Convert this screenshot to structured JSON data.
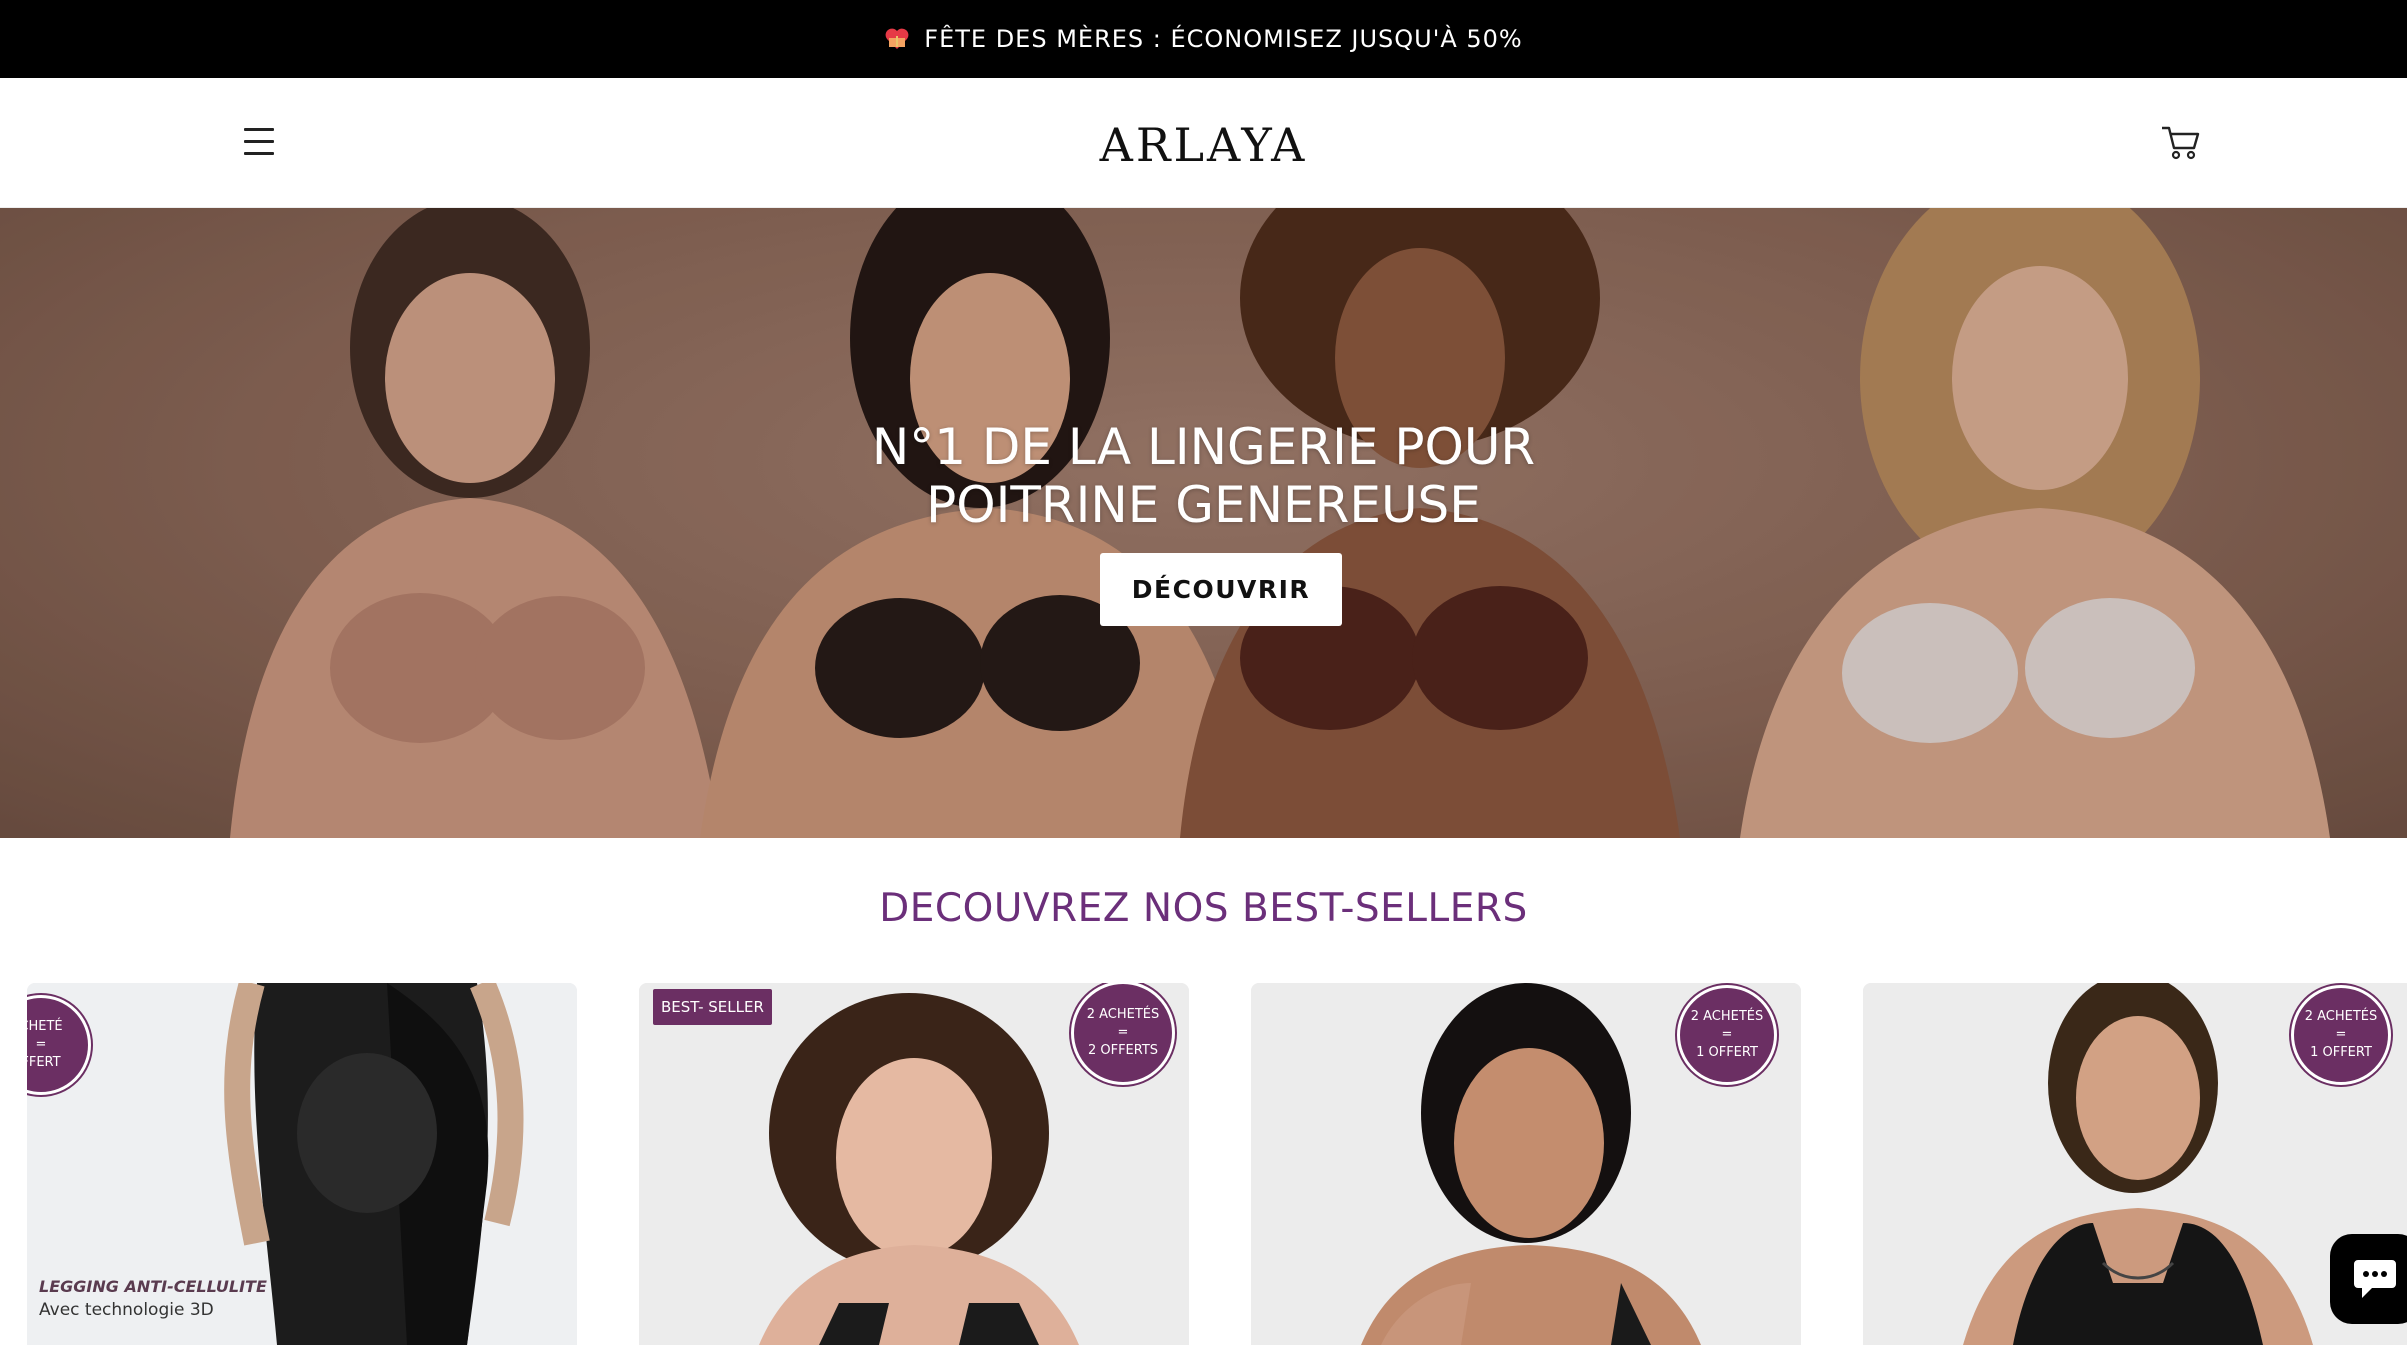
{
  "announcement": {
    "text": "FÊTE DES MÈRES : ÉCONOMISEZ JUSQU'À 50%",
    "icon": "heart-gift-icon"
  },
  "header": {
    "logo": "ARLAYA",
    "menu_icon": "hamburger-icon",
    "cart_icon": "cart-icon"
  },
  "hero": {
    "title_line1": "N°1 DE LA LINGERIE POUR",
    "title_line2": "POITRINE GENEREUSE",
    "cta": "DÉCOUVRIR"
  },
  "bestsellers": {
    "title": "DECOUVREZ NOS BEST-SELLERS",
    "products": [
      {
        "badge": [
          "CHETÉ",
          "=",
          "FFERT"
        ],
        "caption_1": "LEGGING ANTI-CELLULITE",
        "caption_2": "Avec technologie 3D"
      },
      {
        "tag": "BEST- SELLER",
        "badge": [
          "2 ACHETÉS",
          "=",
          "2 OFFERTS"
        ]
      },
      {
        "badge": [
          "2 ACHETÉS",
          "=",
          "1 OFFERT"
        ]
      },
      {
        "badge": [
          "2 ACHETÉS",
          "=",
          "1 OFFERT"
        ]
      }
    ]
  },
  "colors": {
    "accent": "#6b2f7a",
    "badge": "#6b2f63",
    "announce_bg": "#000000"
  },
  "chat": {
    "icon": "chat-bubble-icon"
  }
}
